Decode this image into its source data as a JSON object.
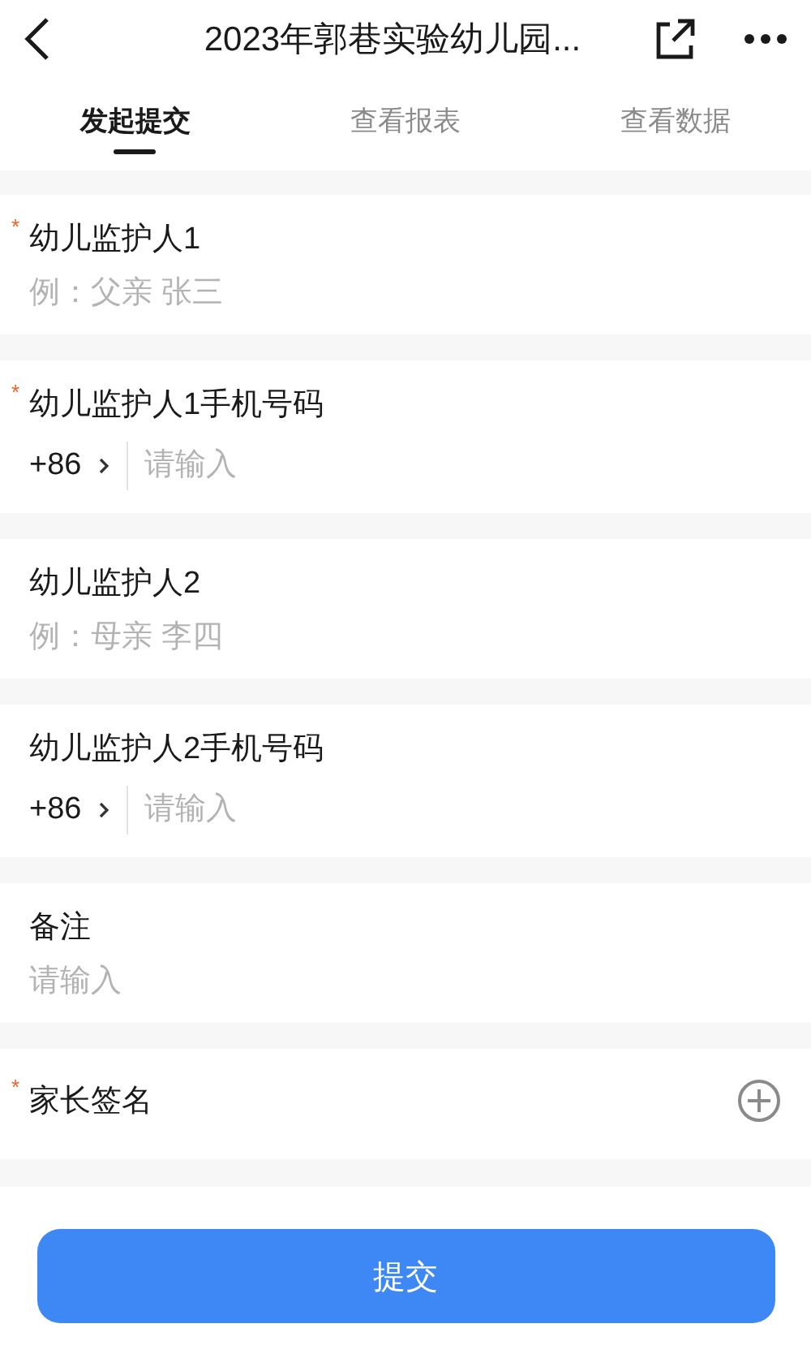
{
  "header": {
    "title": "2023年郭巷实验幼儿园..."
  },
  "tabs": [
    {
      "label": "发起提交",
      "selected": true
    },
    {
      "label": "查看报表",
      "selected": false
    },
    {
      "label": "查看数据",
      "selected": false
    }
  ],
  "fields": [
    {
      "kind": "text",
      "mark": "*",
      "label": "幼儿监护人1",
      "placeholder": "例：父亲 张三"
    },
    {
      "kind": "phone",
      "mark": "*",
      "label": "幼儿监护人1手机号码",
      "prefix": "+86",
      "placeholder": "请输入"
    },
    {
      "kind": "text",
      "label": "幼儿监护人2",
      "placeholder": "例：母亲 李四"
    },
    {
      "kind": "phone",
      "label": "幼儿监护人2手机号码",
      "prefix": "+86",
      "placeholder": "请输入"
    },
    {
      "kind": "text",
      "label": "备注",
      "placeholder": "请输入"
    },
    {
      "kind": "signature",
      "mark": "*",
      "label": "家长签名"
    }
  ],
  "submit": {
    "label": "提交"
  }
}
